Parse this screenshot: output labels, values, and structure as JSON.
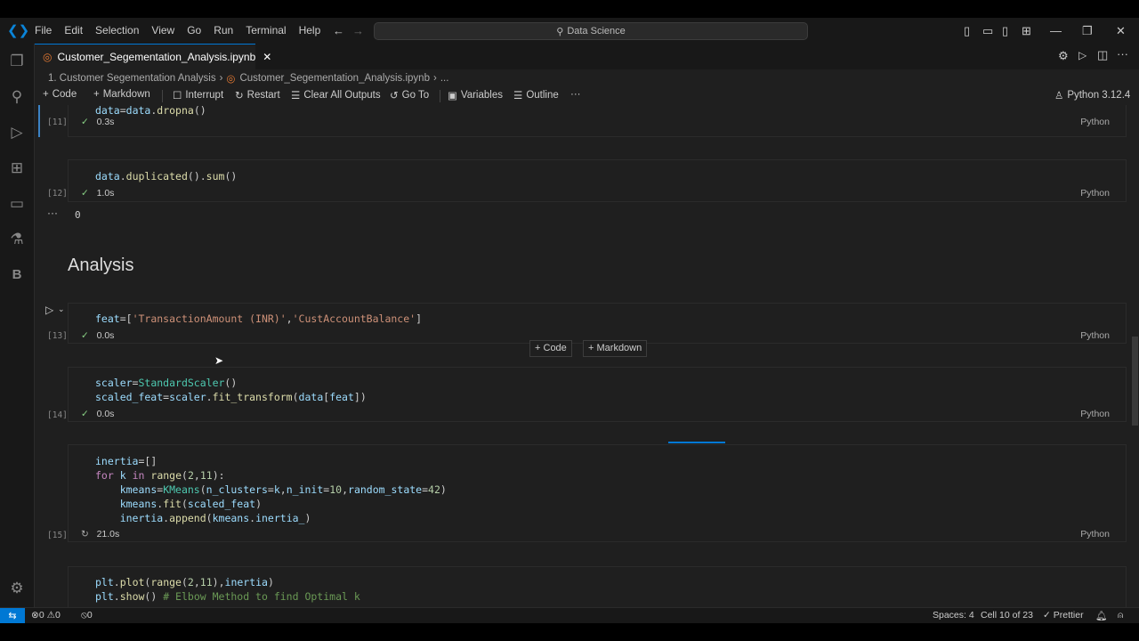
{
  "menu": [
    "File",
    "Edit",
    "Selection",
    "View",
    "Go",
    "Run",
    "Terminal",
    "Help"
  ],
  "search": {
    "label": "Data Science"
  },
  "tab": {
    "title": "Customer_Segementation_Analysis.ipynb"
  },
  "breadcrumb": {
    "part1": "1. Customer Segementation Analysis",
    "part2": "Customer_Segementation_Analysis.ipynb",
    "part3": "..."
  },
  "toolbar": {
    "code": "Code",
    "markdown": "Markdown",
    "interrupt": "Interrupt",
    "restart": "Restart",
    "clear": "Clear All Outputs",
    "goto": "Go To",
    "variables": "Variables",
    "outline": "Outline",
    "more": "···",
    "kernel": "Python 3.12.4"
  },
  "cells": [
    {
      "count": "[11]",
      "time": "0.3s",
      "lang": "Python"
    },
    {
      "count": "[12]",
      "time": "1.0s",
      "lang": "Python",
      "output": "0"
    },
    {
      "heading": "Analysis"
    },
    {
      "count": "[13]",
      "time": "0.0s",
      "lang": "Python"
    },
    {
      "count": "[14]",
      "time": "0.0s",
      "lang": "Python"
    },
    {
      "count": "[15]",
      "time": "21.0s",
      "lang": "Python"
    },
    {}
  ],
  "insert": {
    "code": "Code",
    "markdown": "Markdown"
  },
  "statusbar": {
    "errors": "0",
    "warnings": "0",
    "ports": "0",
    "spaces": "Spaces: 4",
    "cell": "Cell 10 of 23",
    "prettier": "Prettier"
  },
  "colors": {
    "accent": "#0078d4",
    "success": "#89d185"
  }
}
